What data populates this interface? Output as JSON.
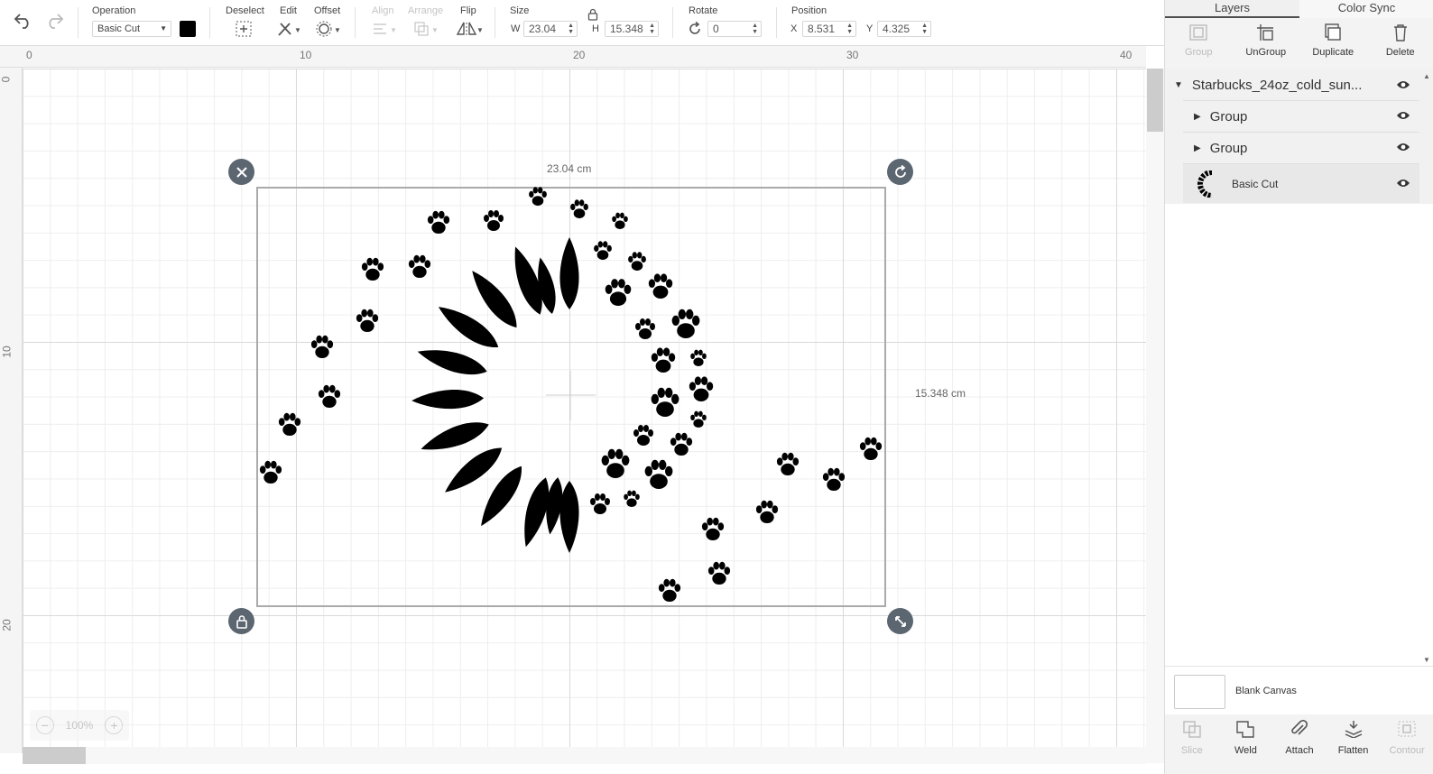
{
  "toolbar": {
    "operation": {
      "label": "Operation",
      "value": "Basic Cut",
      "color": "#000000"
    },
    "deselect": "Deselect",
    "edit": "Edit",
    "offset": "Offset",
    "align": "Align",
    "arrange": "Arrange",
    "flip": "Flip",
    "size": {
      "label": "Size",
      "w_label": "W",
      "w": "23.04",
      "h_label": "H",
      "h": "15.348"
    },
    "rotate": {
      "label": "Rotate",
      "value": "0"
    },
    "position": {
      "label": "Position",
      "x_label": "X",
      "x": "8.531",
      "y_label": "Y",
      "y": "4.325"
    }
  },
  "ruler": {
    "top": [
      "0",
      "10",
      "20",
      "30",
      "40"
    ],
    "left": [
      "0",
      "10",
      "20"
    ]
  },
  "canvas": {
    "width_label": "23.04 cm",
    "height_label": "15.348 cm",
    "zoom": "100%"
  },
  "panel": {
    "tabs": [
      "Layers",
      "Color Sync"
    ],
    "tools": [
      {
        "label": "Group",
        "icon": "group-icon",
        "enabled": false
      },
      {
        "label": "UnGroup",
        "icon": "ungroup-icon",
        "enabled": true
      },
      {
        "label": "Duplicate",
        "icon": "duplicate-icon",
        "enabled": true
      },
      {
        "label": "Delete",
        "icon": "trash-icon",
        "enabled": true
      }
    ],
    "layers": {
      "root": "Starbucks_24oz_cold_sun...",
      "children": [
        "Group",
        "Group"
      ],
      "item": "Basic Cut"
    },
    "canvas_label": "Blank Canvas",
    "bottom_tools": [
      {
        "label": "Slice",
        "enabled": false
      },
      {
        "label": "Weld",
        "enabled": true
      },
      {
        "label": "Attach",
        "enabled": true
      },
      {
        "label": "Flatten",
        "enabled": true
      },
      {
        "label": "Contour",
        "enabled": false
      }
    ]
  }
}
